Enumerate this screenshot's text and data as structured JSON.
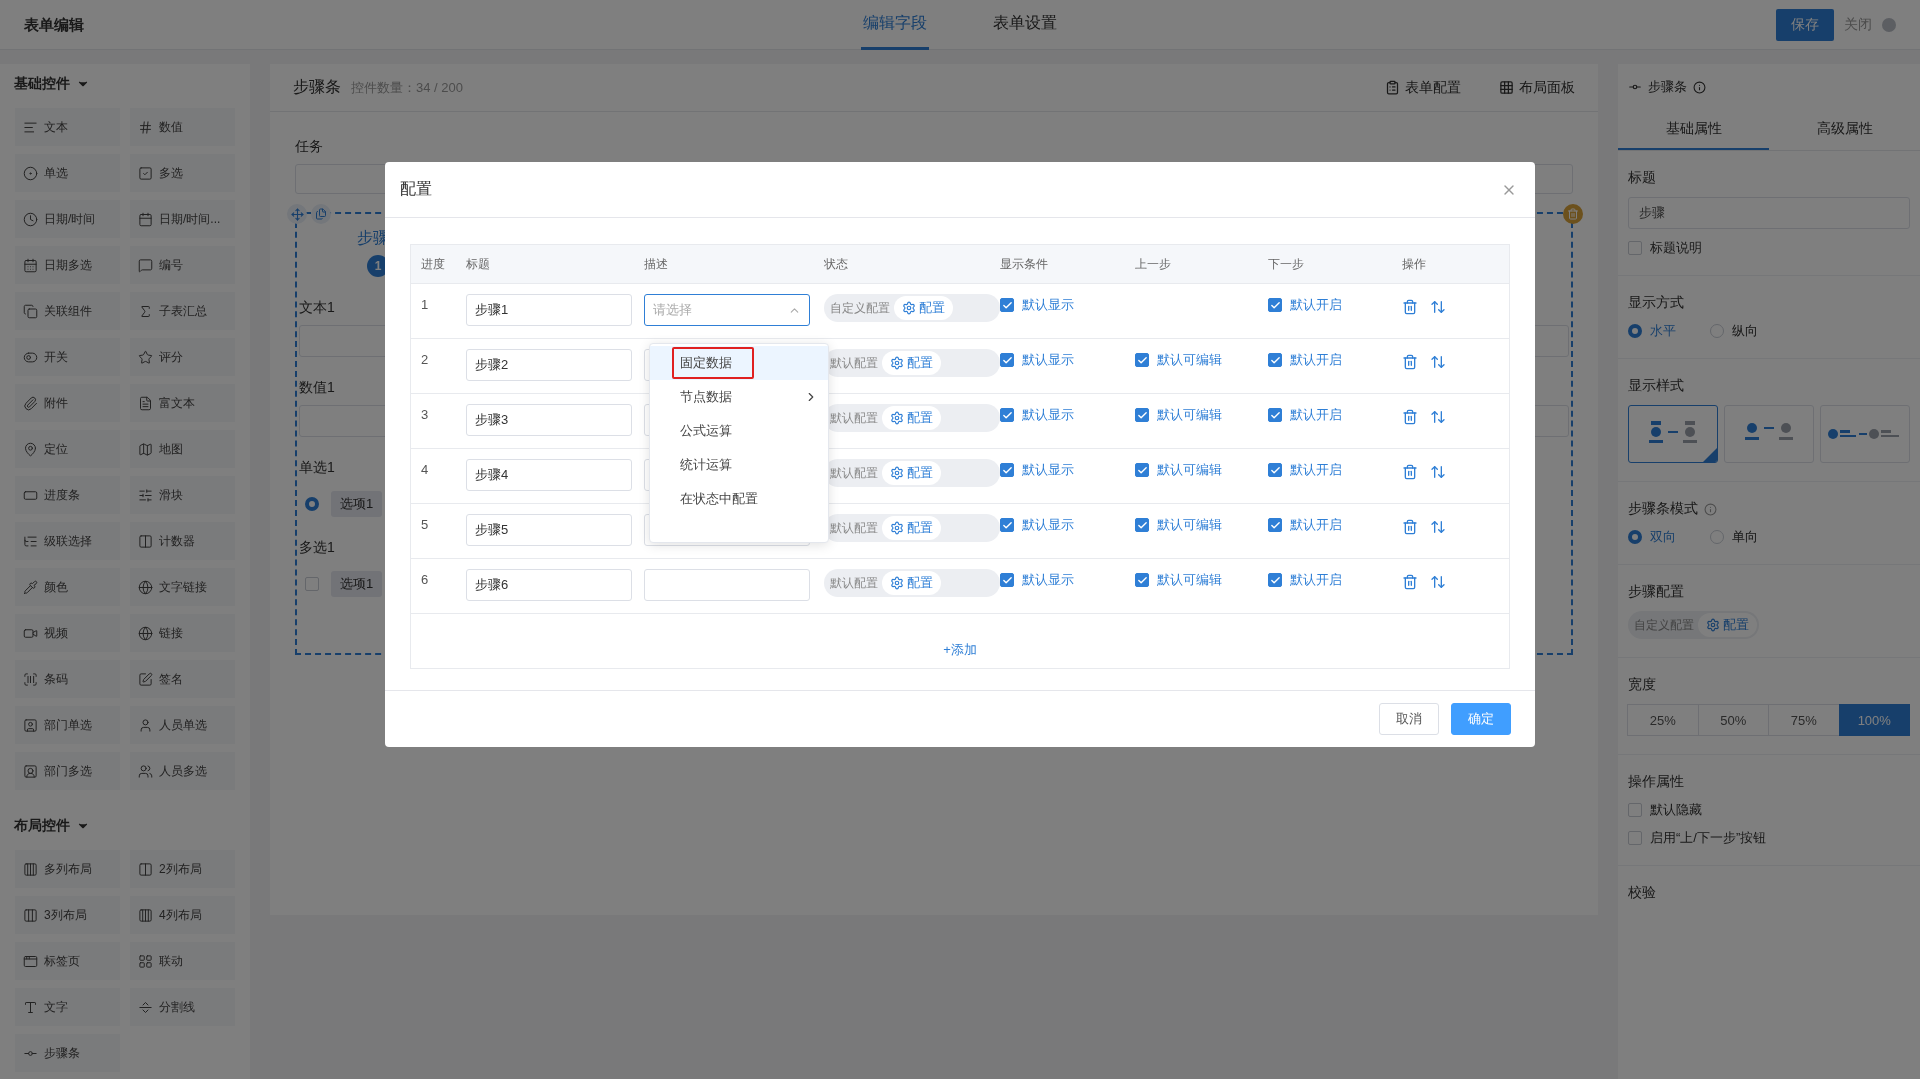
{
  "header": {
    "title": "表单编辑",
    "tabs": [
      {
        "label": "编辑字段",
        "selected": true
      },
      {
        "label": "表单设置",
        "selected": false
      }
    ],
    "save": "保存",
    "close": "关闭"
  },
  "sidebar": {
    "groups": [
      {
        "title": "基础控件",
        "expanded": true,
        "items": [
          "文本",
          "数值",
          "单选",
          "多选",
          "日期/时间",
          "日期/时间...",
          "日期多选",
          "编号",
          "关联组件",
          "子表汇总",
          "开关",
          "评分",
          "附件",
          "富文本",
          "定位",
          "地图",
          "进度条",
          "滑块",
          "级联选择",
          "计数器",
          "颜色",
          "文字链接",
          "视频",
          "链接",
          "条码",
          "签名",
          "部门单选",
          "人员单选",
          "部门多选",
          "人员多选"
        ]
      },
      {
        "title": "布局控件",
        "expanded": true,
        "items": [
          "多列布局",
          "2列布局",
          "3列布局",
          "4列布局",
          "标签页",
          "联动",
          "文字",
          "分割线",
          "步骤条"
        ]
      }
    ]
  },
  "canvas": {
    "title": "步骤条",
    "count": "控件数量：34 / 200",
    "actions": [
      "表单配置",
      "布局面板"
    ],
    "task_label": "任务",
    "step_label": "步骤",
    "step_number": "1",
    "fields": [
      {
        "kind": "input",
        "label": "文本1"
      },
      {
        "kind": "input",
        "label": "数值1"
      },
      {
        "kind": "radio",
        "label": "单选1",
        "option": "选项1",
        "checked": true
      },
      {
        "kind": "checkbox",
        "label": "多选1",
        "option": "选项1",
        "checked": false
      }
    ]
  },
  "dialog": {
    "title": "配置",
    "columns": [
      "进度",
      "标题",
      "描述",
      "状态",
      "显示条件",
      "上一步",
      "下一步",
      "操作"
    ],
    "rows": [
      {
        "index": "1",
        "title": "步骤1",
        "select": {
          "placeholder": "请选择",
          "expanded": true
        },
        "status": "自定义配置",
        "action": "配置",
        "show": {
          "label": "默认显示",
          "checked": true
        },
        "next": {
          "label": "默认开启",
          "checked": true
        }
      },
      {
        "index": "2",
        "title": "步骤2",
        "status": "默认配置",
        "action": "配置",
        "show": {
          "label": "默认显示",
          "checked": true
        },
        "prev": {
          "label": "默认可编辑",
          "checked": true
        },
        "next": {
          "label": "默认开启",
          "checked": true
        }
      },
      {
        "index": "3",
        "title": "步骤3",
        "status": "默认配置",
        "action": "配置",
        "show": {
          "label": "默认显示",
          "checked": true
        },
        "prev": {
          "label": "默认可编辑",
          "checked": true
        },
        "next": {
          "label": "默认开启",
          "checked": true
        }
      },
      {
        "index": "4",
        "title": "步骤4",
        "status": "默认配置",
        "action": "配置",
        "show": {
          "label": "默认显示",
          "checked": true
        },
        "prev": {
          "label": "默认可编辑",
          "checked": true
        },
        "next": {
          "label": "默认开启",
          "checked": true
        }
      },
      {
        "index": "5",
        "title": "步骤5",
        "status": "默认配置",
        "action": "配置",
        "show": {
          "label": "默认显示",
          "checked": true
        },
        "prev": {
          "label": "默认可编辑",
          "checked": true
        },
        "next": {
          "label": "默认开启",
          "checked": true
        }
      },
      {
        "index": "6",
        "title": "步骤6",
        "status": "默认配置",
        "action": "配置",
        "show": {
          "label": "默认显示",
          "checked": true
        },
        "prev": {
          "label": "默认可编辑",
          "checked": true
        },
        "next": {
          "label": "默认开启",
          "checked": true
        }
      }
    ],
    "dropdown": [
      {
        "label": "固定数据",
        "kind": "option",
        "selected": true,
        "highlighted": true
      },
      {
        "label": "节点数据",
        "kind": "submenu",
        "selected": false,
        "highlighted": false
      },
      {
        "label": "公式运算",
        "kind": "option",
        "selected": false,
        "highlighted": false
      },
      {
        "label": "统计运算",
        "kind": "option",
        "selected": false,
        "highlighted": false
      },
      {
        "label": "在状态中配置",
        "kind": "option",
        "selected": false,
        "highlighted": false
      }
    ],
    "add": "+添加",
    "buttons": [
      {
        "label": "取消",
        "kind": "default"
      },
      {
        "label": "确定",
        "kind": "primary"
      }
    ]
  },
  "properties": {
    "title": "步骤条",
    "tabs": [
      {
        "label": "基础属性",
        "selected": true
      },
      {
        "label": "高级属性",
        "selected": false
      }
    ],
    "sections": [
      {
        "kind": "input",
        "label": "标题",
        "value": "步骤",
        "check": {
          "label": "标题说明",
          "checked": false
        }
      },
      {
        "kind": "radio",
        "label": "显示方式",
        "options": [
          {
            "label": "水平",
            "selected": true
          },
          {
            "label": "纵向",
            "selected": false
          }
        ]
      },
      {
        "kind": "styles",
        "label": "显示样式",
        "options": [
          {
            "selected": true
          },
          {
            "selected": false
          },
          {
            "selected": false
          }
        ]
      },
      {
        "kind": "radio",
        "label": "步骤条模式",
        "info": true,
        "options": [
          {
            "label": "双向",
            "selected": true
          },
          {
            "label": "单向",
            "selected": false
          }
        ]
      },
      {
        "kind": "config",
        "label": "步骤配置",
        "status": "自定义配置",
        "action": "配置"
      },
      {
        "kind": "segmented",
        "label": "宽度",
        "options": [
          {
            "label": "25%",
            "selected": false
          },
          {
            "label": "50%",
            "selected": false
          },
          {
            "label": "75%",
            "selected": false
          },
          {
            "label": "100%",
            "selected": true
          }
        ]
      },
      {
        "kind": "checks",
        "label": "操作属性",
        "options": [
          {
            "label": "默认隐藏",
            "checked": false
          },
          {
            "label": "启用“上/下一步”按钮",
            "checked": false
          }
        ]
      },
      {
        "kind": "heading",
        "label": "校验"
      }
    ]
  }
}
